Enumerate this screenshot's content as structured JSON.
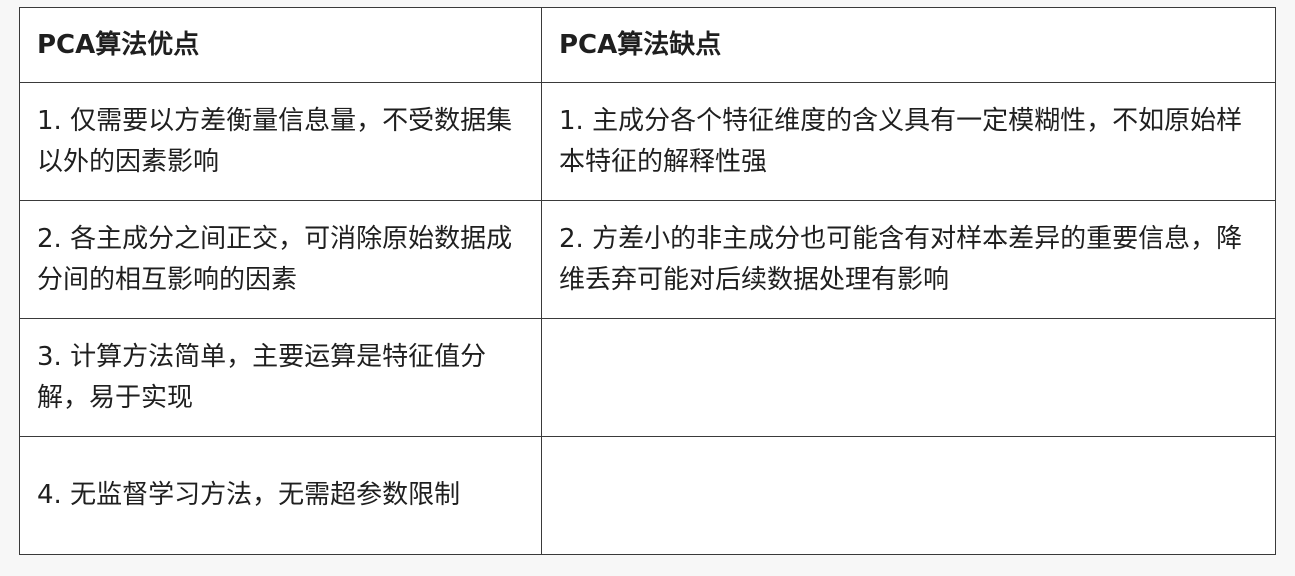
{
  "table": {
    "headers": [
      "PCA算法优点",
      "PCA算法缺点"
    ],
    "rows": [
      [
        "1. 仅需要以方差衡量信息量，不受数据集以外的因素影响",
        "1. 主成分各个特征维度的含义具有一定模糊性，不如原始样本特征的解释性强"
      ],
      [
        "2. 各主成分之间正交，可消除原始数据成分间的相互影响的因素",
        "2. 方差小的非主成分也可能含有对样本差异的重要信息，降维丢弃可能对后续数据处理有影响"
      ],
      [
        "3. 计算方法简单，主要运算是特征值分解，易于实现",
        ""
      ],
      [
        "4. 无监督学习方法，无需超参数限制",
        ""
      ]
    ]
  }
}
